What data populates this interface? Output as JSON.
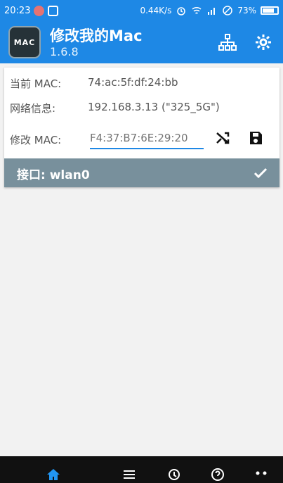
{
  "status": {
    "time": "20:23",
    "network_speed": "0.44K/s",
    "battery_percent": "73%"
  },
  "app": {
    "logo_text": "MAC",
    "title": "修改我的Mac",
    "version": "1.6.8"
  },
  "fields": {
    "current_mac_label": "当前 MAC:",
    "current_mac_value": "74:ac:5f:df:24:bb",
    "network_info_label": "网络信息:",
    "network_info_value": "192.168.3.13 (\"325_5G\")",
    "modify_mac_label": "修改 MAC:",
    "modify_mac_placeholder": "F4:37:B7:6E:29:20"
  },
  "interface": {
    "label": "接口: wlan0"
  },
  "colors": {
    "primary": "#1e88e5",
    "interface_bar": "#78909c",
    "bottom_bar": "#111111"
  },
  "icons": {
    "network": "network-icon",
    "settings": "settings-icon",
    "shuffle": "shuffle-icon",
    "save": "save-icon",
    "check": "check-icon",
    "home": "home-icon",
    "list": "list-icon",
    "history": "history-icon",
    "help": "help-icon",
    "more": "more-icon"
  }
}
